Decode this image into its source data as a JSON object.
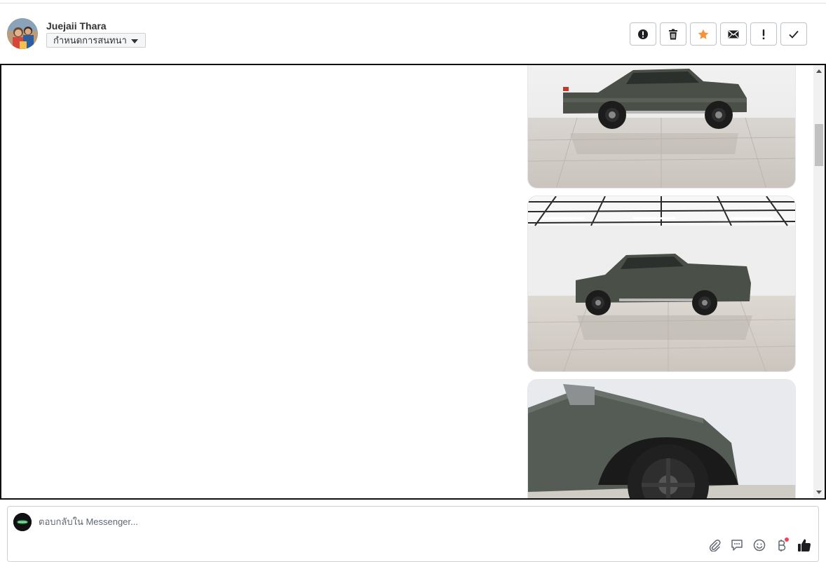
{
  "header": {
    "user_name": "Juejaii Thara",
    "assign_label": "กำหนดการสนทนา",
    "actions": [
      {
        "name": "mark-spam",
        "icon": "exclamation-circle-icon"
      },
      {
        "name": "delete",
        "icon": "trash-icon"
      },
      {
        "name": "star",
        "icon": "star-icon",
        "color": "#f7923b"
      },
      {
        "name": "mark-unread",
        "icon": "envelope-icon"
      },
      {
        "name": "follow-up",
        "icon": "exclamation-icon"
      },
      {
        "name": "mark-done",
        "icon": "check-icon"
      }
    ]
  },
  "conversation": {
    "photos": [
      {
        "alt": "pickup-truck-side-view",
        "icon": "image-icon"
      },
      {
        "alt": "pickup-truck-side-view-showroom",
        "icon": "image-icon"
      },
      {
        "alt": "pickup-truck-front-wheel-closeup",
        "icon": "image-icon"
      }
    ]
  },
  "reply": {
    "placeholder": "ตอบกลับใน Messenger...",
    "tools": [
      "paperclip-icon",
      "chat-bubble-icon",
      "smiley-icon",
      "baht-icon",
      "thumbs-up-icon"
    ],
    "notification_dot_color": "#fa3e5b"
  },
  "colors": {
    "accent_star": "#f7923b",
    "border": "#bec3c9",
    "frame": "#111111"
  }
}
